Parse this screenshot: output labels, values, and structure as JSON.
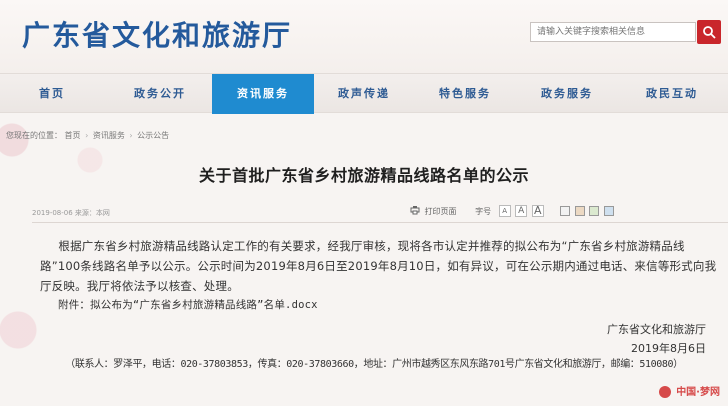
{
  "header": {
    "site_title": "广东省文化和旅游厅",
    "search_placeholder": "请输入关键字搜索相关信息"
  },
  "nav": {
    "items": [
      {
        "label": "首页"
      },
      {
        "label": "政务公开"
      },
      {
        "label": "资讯服务"
      },
      {
        "label": "政声传递"
      },
      {
        "label": "特色服务"
      },
      {
        "label": "政务服务"
      },
      {
        "label": "政民互动"
      }
    ],
    "active_index": 2
  },
  "breadcrumb": {
    "prefix": "您现在的位置：",
    "items": [
      "首页",
      "资讯服务",
      "公示公告"
    ]
  },
  "article": {
    "title": "关于首批广东省乡村旅游精品线路名单的公示",
    "meta_left": "2019-08-06   来源：本网",
    "print_label": "打印页面",
    "font_label": "字号",
    "font_sizes": [
      "A",
      "A",
      "A"
    ],
    "paragraph": "根据广东省乡村旅游精品线路认定工作的有关要求，经我厅审核，现将各市认定并推荐的拟公布为“广东省乡村旅游精品线路”100条线路名单予以公示。公示时间为2019年8月6日至2019年8月10日，如有异议，可在公示期内通过电话、来信等形式向我厅反映。我厅将依法予以核查、处理。",
    "attachment": "附件：拟公布为“广东省乡村旅游精品线路”名单.docx",
    "signature_org": "广东省文化和旅游厅",
    "signature_date": "2019年8月6日",
    "contact": "（联系人：罗泽平，电话：020-37803853，传真：020-37803660，地址：广州市越秀区东风东路701号广东省文化和旅游厅，邮编：510080）"
  },
  "watermark": {
    "text": "中国·梦网"
  },
  "colors": {
    "brand_blue": "#245a9c",
    "nav_active": "#1f8bd0",
    "search_button": "#c9262b",
    "swatches": [
      "#f2f2f2",
      "#ecd9c3",
      "#dbe9cf",
      "#cfe0ef"
    ]
  }
}
